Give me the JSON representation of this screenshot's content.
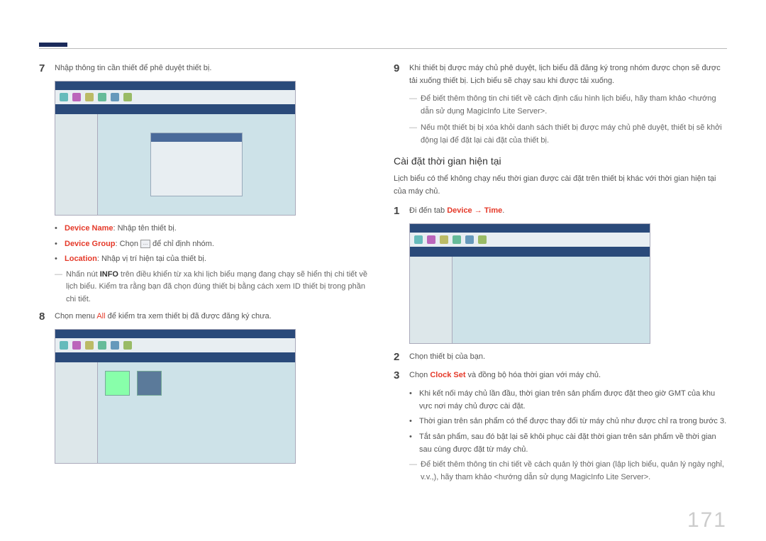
{
  "page_number": "171",
  "left": {
    "step7": "Nhập thông tin cần thiết để phê duyệt thiết bị.",
    "bullet_devicename_label": "Device Name",
    "bullet_devicename_text": ": Nhập tên thiết bị.",
    "bullet_devicegroup_label": "Device Group",
    "bullet_devicegroup_text_a": ": Chọn ",
    "bullet_devicegroup_text_b": " để chỉ định nhóm.",
    "bullet_location_label": "Location",
    "bullet_location_text": ": Nhập vị trí hiện tại của thiết bị.",
    "note_info_a": "Nhấn nút ",
    "note_info_b": "INFO",
    "note_info_c": " trên điều khiển từ xa khi lịch biểu mạng đang chạy sẽ hiển thị chi tiết về lịch biểu. Kiểm tra rằng bạn đã chọn đúng thiết bị bằng cách xem ID thiết bị trong phần chi tiết.",
    "step8_a": "Chọn menu ",
    "step8_b": "All",
    "step8_c": " để kiểm tra xem thiết bị đã được đăng ký chưa.",
    "icon_ellipsis": "…"
  },
  "right": {
    "step9": "Khi thiết bị được máy chủ phê duyệt, lịch biểu đã đăng ký trong nhóm được chọn sẽ được tải xuống thiết bị. Lịch biểu sẽ chạy sau khi được tải xuống.",
    "note1": "Để biết thêm thông tin chi tiết về cách định cấu hình lịch biểu, hãy tham khảo <hướng dẫn sử dụng MagicInfo Lite Server>.",
    "note2": "Nếu một thiết bị bị xóa khỏi danh sách thiết bị được máy chủ phê duyệt, thiết bị sẽ khởi động lại để đặt lại cài đặt của thiết bị.",
    "heading": "Cài đặt thời gian hiện tại",
    "intro": "Lịch biểu có thể không chạy nếu thời gian được cài đặt trên thiết bị khác với thời gian hiện tại của máy chủ.",
    "step1_a": "Đi đến tab ",
    "step1_b": "Device → Time",
    "step1_c": ".",
    "step2": "Chọn thiết bị của bạn.",
    "step3_a": "Chọn ",
    "step3_b": "Clock Set",
    "step3_c": " và đồng bộ hóa thời gian với máy chủ.",
    "sub_b1": "Khi kết nối máy chủ lần đầu, thời gian trên sản phẩm được đặt theo giờ GMT của khu vực nơi máy chủ được cài đặt.",
    "sub_b2": "Thời gian trên sản phẩm có thể được thay đổi từ máy chủ như được chỉ ra trong bước 3.",
    "sub_b3": "Tắt sản phẩm, sau đó bật lại sẽ khôi phục cài đặt thời gian trên sản phẩm về thời gian sau cùng được đặt từ máy chủ.",
    "note3": "Để biết thêm thông tin chi tiết về cách quản lý thời gian (lập lịch biểu, quản lý ngày nghỉ, v.v.,), hãy tham khảo <hướng dẫn sử dụng MagicInfo Lite Server>."
  }
}
